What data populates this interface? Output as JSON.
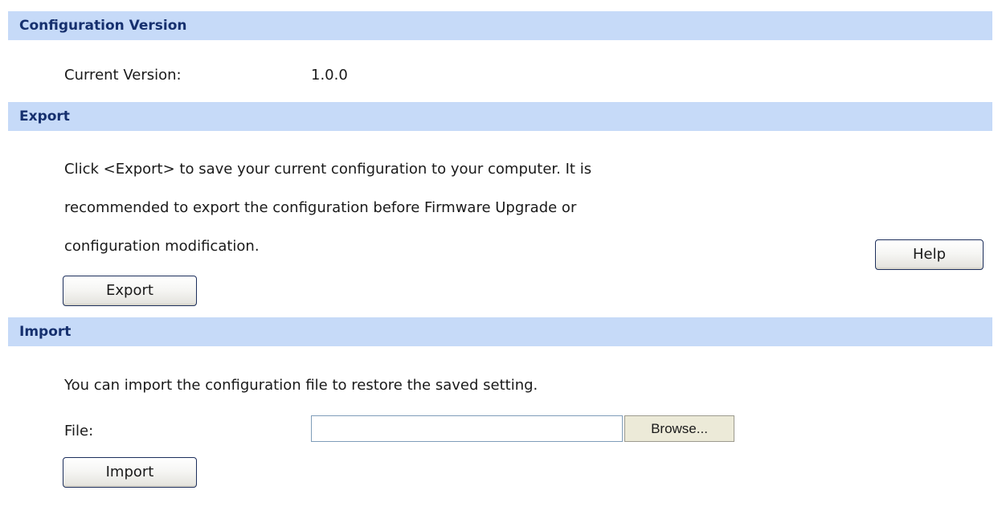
{
  "sections": {
    "config_version": {
      "title": "Configuration Version",
      "current_version_label": "Current Version:",
      "current_version_value": "1.0.0"
    },
    "export": {
      "title": "Export",
      "description_lines": [
        "Click <Export> to save your current configuration to your computer. It is",
        "recommended to export the configuration before Firmware Upgrade or",
        "configuration modification."
      ],
      "export_button": "Export",
      "help_button": "Help"
    },
    "import": {
      "title": "Import",
      "description": "You can import the configuration file to restore the saved setting.",
      "file_label": "File:",
      "file_value": "",
      "browse_button": "Browse...",
      "import_button": "Import"
    }
  },
  "colors": {
    "header_bg": "#c6daf8",
    "header_text": "#16306e"
  }
}
